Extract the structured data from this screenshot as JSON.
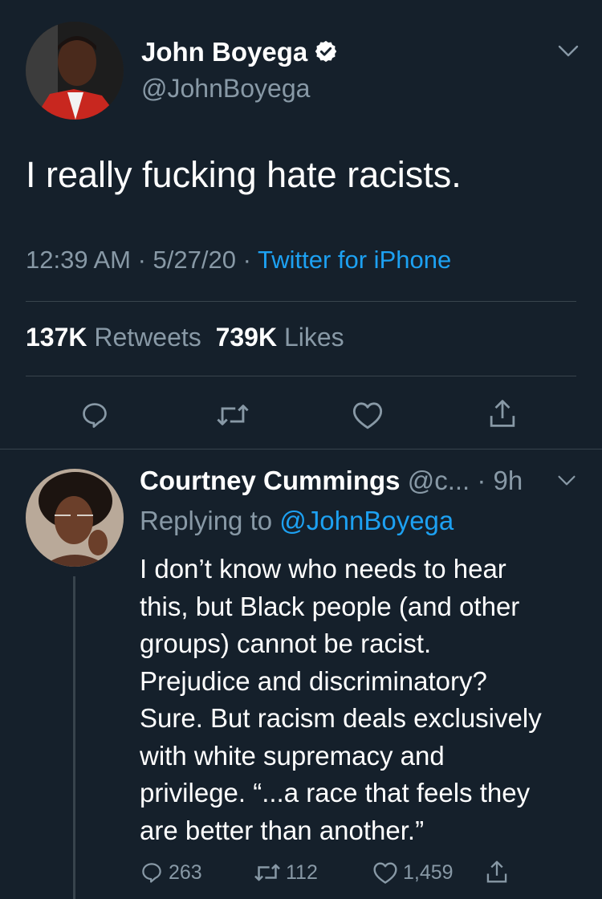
{
  "main_tweet": {
    "author_name": "John Boyega",
    "handle": "@JohnBoyega",
    "text": "I really fucking hate racists.",
    "time": "12:39 AM",
    "date": "5/27/20",
    "source": "Twitter for iPhone",
    "retweets_count": "137K",
    "retweets_label": "Retweets",
    "likes_count": "739K",
    "likes_label": "Likes",
    "icons": {
      "avatar": "avatar",
      "verified": "verified-badge-icon",
      "more": "chevron-down-icon",
      "reply": "reply-icon",
      "retweet": "retweet-icon",
      "like": "heart-icon",
      "share": "share-icon"
    }
  },
  "reply": {
    "author_name": "Courtney Cummings",
    "handle_truncated": "@c...",
    "time_ago": "9h",
    "replying_prefix": "Replying to",
    "replying_to": "@JohnBoyega",
    "lines": [
      "I don’t know who needs to hear",
      "this, but Black people (and other",
      "groups) cannot be racist.",
      "Prejudice and discriminatory?",
      "Sure. But racism deals exclusively",
      "with white supremacy and",
      "privilege. “...a race that feels they",
      "are better than another.”"
    ],
    "reply_count": "263",
    "retweet_count": "112",
    "like_count": "1,459"
  },
  "colors": {
    "background": "#15202b",
    "muted": "#8899a6",
    "link": "#1da1f2",
    "divider": "#38444d"
  }
}
